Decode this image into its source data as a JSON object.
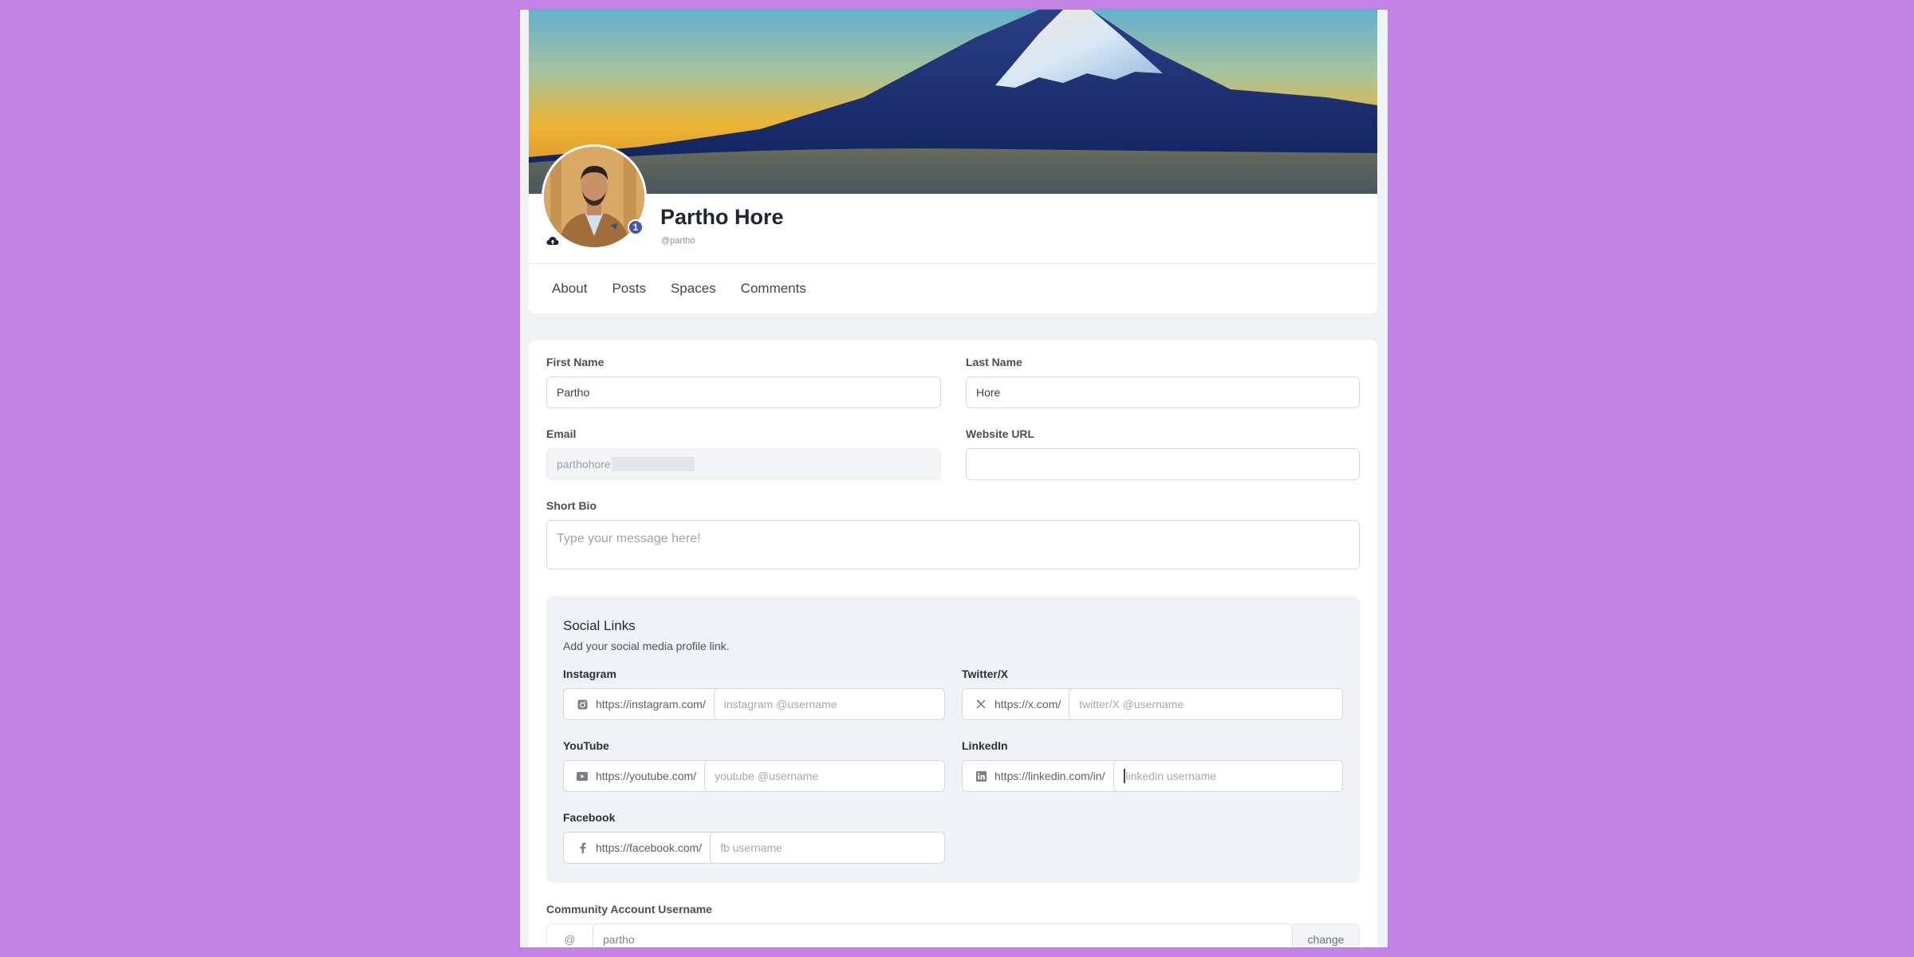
{
  "profile": {
    "name": "Partho Hore",
    "handle": "@partho",
    "notification_count": "1"
  },
  "tabs": [
    {
      "label": "About"
    },
    {
      "label": "Posts"
    },
    {
      "label": "Spaces"
    },
    {
      "label": "Comments"
    }
  ],
  "form": {
    "first_name": {
      "label": "First Name",
      "value": "Partho"
    },
    "last_name": {
      "label": "Last Name",
      "value": "Hore"
    },
    "email": {
      "label": "Email",
      "value": "parthohore"
    },
    "website": {
      "label": "Website URL",
      "value": ""
    },
    "bio": {
      "label": "Short Bio",
      "placeholder": "Type your message here!"
    }
  },
  "social": {
    "title": "Social Links",
    "subtitle": "Add your social media profile link.",
    "links": [
      {
        "name": "Instagram",
        "icon": "instagram-icon",
        "prefix": "https://instagram.com/",
        "placeholder": "instagram @username"
      },
      {
        "name": "Twitter/X",
        "icon": "x-icon",
        "prefix": "https://x.com/",
        "placeholder": "twitter/X @username"
      },
      {
        "name": "YouTube",
        "icon": "youtube-icon",
        "prefix": "https://youtube.com/",
        "placeholder": "youtube @username"
      },
      {
        "name": "LinkedIn",
        "icon": "linkedin-icon",
        "prefix": "https://linkedin.com/in/",
        "placeholder": "linkedin username"
      },
      {
        "name": "Facebook",
        "icon": "facebook-icon",
        "prefix": "https://facebook.com/",
        "placeholder": "fb username"
      }
    ]
  },
  "community_username": {
    "label": "Community Account Username",
    "prefix": "@",
    "value": "partho",
    "button": "change"
  },
  "colors": {
    "background": "#c285e6",
    "badge": "#4453b5",
    "title_text": "#1e2533"
  }
}
